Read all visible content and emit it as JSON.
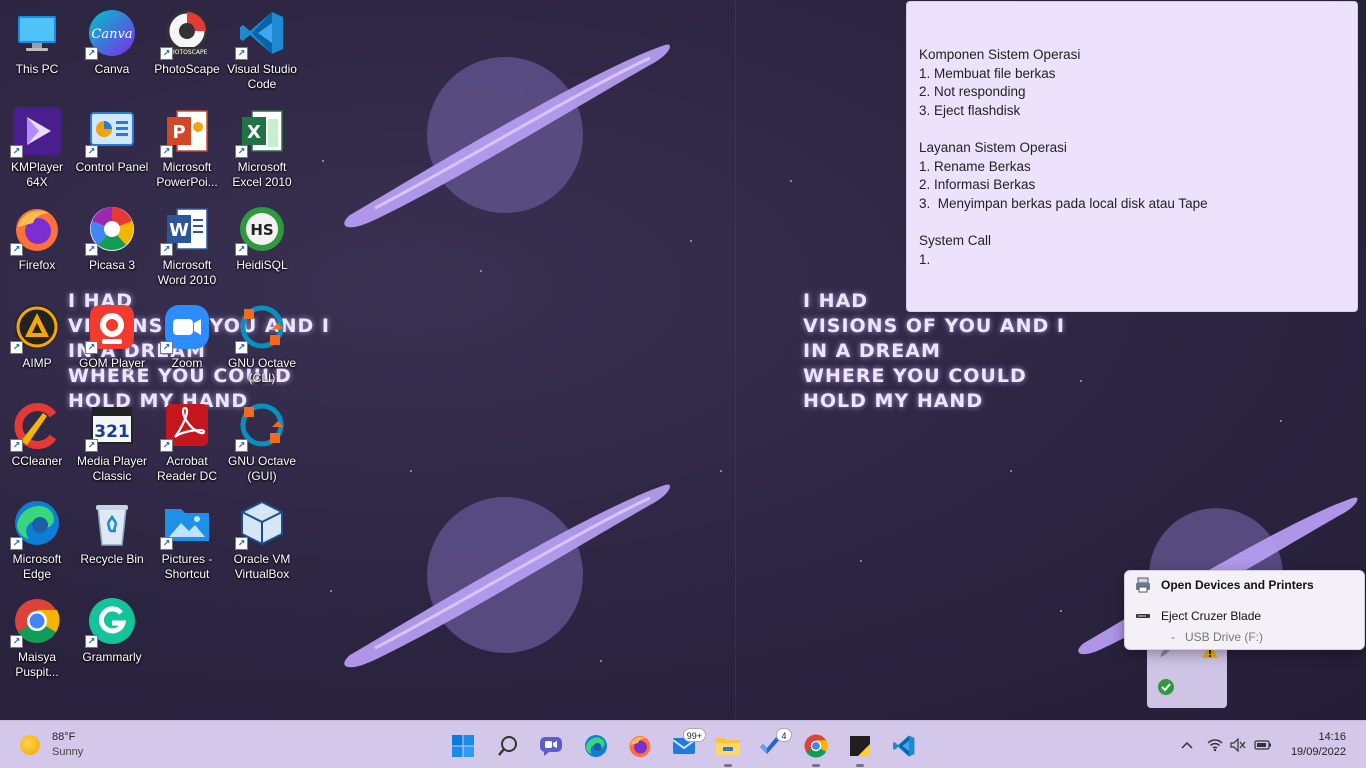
{
  "desktop": {
    "icons": [
      {
        "label": "This PC",
        "icon": "this-pc-icon"
      },
      {
        "label": "Canva",
        "icon": "canva-icon"
      },
      {
        "label": "PhotoScape",
        "icon": "photoscape-icon"
      },
      {
        "label": "Visual Studio Code",
        "icon": "vscode-icon"
      },
      {
        "label": "KMPlayer 64X",
        "icon": "kmplayer-icon"
      },
      {
        "label": "Control Panel",
        "icon": "control-panel-icon"
      },
      {
        "label": "Microsoft PowerPoi...",
        "icon": "powerpoint-icon"
      },
      {
        "label": "Microsoft Excel 2010",
        "icon": "excel-icon"
      },
      {
        "label": "Firefox",
        "icon": "firefox-icon"
      },
      {
        "label": "Picasa 3",
        "icon": "picasa-icon"
      },
      {
        "label": "Microsoft Word 2010",
        "icon": "word-icon"
      },
      {
        "label": "HeidiSQL",
        "icon": "heidisql-icon"
      },
      {
        "label": "AIMP",
        "icon": "aimp-icon"
      },
      {
        "label": "GOM Player",
        "icon": "gom-player-icon"
      },
      {
        "label": "Zoom",
        "icon": "zoom-icon"
      },
      {
        "label": "GNU Octave (CLI)",
        "icon": "octave-icon"
      },
      {
        "label": "CCleaner",
        "icon": "ccleaner-icon"
      },
      {
        "label": "Media Player Classic",
        "icon": "media-player-classic-icon"
      },
      {
        "label": "Acrobat Reader DC",
        "icon": "acrobat-icon"
      },
      {
        "label": "GNU Octave (GUI)",
        "icon": "octave-icon"
      },
      {
        "label": "Microsoft Edge",
        "icon": "edge-icon"
      },
      {
        "label": "Recycle Bin",
        "icon": "recycle-bin-icon"
      },
      {
        "label": "Pictures - Shortcut",
        "icon": "pictures-folder-icon"
      },
      {
        "label": "Oracle VM VirtualBox",
        "icon": "virtualbox-icon"
      },
      {
        "label": "Maisya Puspit...",
        "icon": "chrome-icon"
      },
      {
        "label": "Grammarly",
        "icon": "grammarly-icon"
      }
    ],
    "wallpaper_text": "I HAD\nVISIONS OF YOU AND I\nIN A DREAM\nWHERE YOU COULD\nHOLD MY HAND"
  },
  "sticky_note": {
    "lines": [
      "Komponen Sistem Operasi",
      "1. Membuat file berkas",
      "2. Not responding",
      "3. Eject flashdisk",
      "",
      "Layanan Sistem Operasi",
      "1. Rename Berkas",
      "2. Informasi Berkas",
      "3.  Menyimpan berkas pada local disk atau Tape",
      "",
      "System Call",
      "1."
    ]
  },
  "usb_menu": {
    "open_devices": "Open Devices and Printers",
    "eject": "Eject Cruzer Blade",
    "drive": "-   USB Drive (F:)"
  },
  "taskbar": {
    "weather_temp": "88°F",
    "weather_desc": "Sunny",
    "apps": [
      {
        "name": "start",
        "icon": "windows-start-icon"
      },
      {
        "name": "search",
        "icon": "search-icon"
      },
      {
        "name": "chat",
        "icon": "chat-icon"
      },
      {
        "name": "edge",
        "icon": "edge-icon"
      },
      {
        "name": "firefox",
        "icon": "firefox-icon"
      },
      {
        "name": "mail",
        "icon": "mail-icon",
        "badge": "99+"
      },
      {
        "name": "file-explorer",
        "icon": "folder-icon"
      },
      {
        "name": "todo",
        "icon": "todo-icon",
        "badge": "4"
      },
      {
        "name": "chrome",
        "icon": "chrome-icon"
      },
      {
        "name": "sticky-notes",
        "icon": "sticky-notes-icon"
      },
      {
        "name": "vscode",
        "icon": "vscode-icon"
      }
    ],
    "time": "14:16",
    "date": "19/09/2022"
  }
}
